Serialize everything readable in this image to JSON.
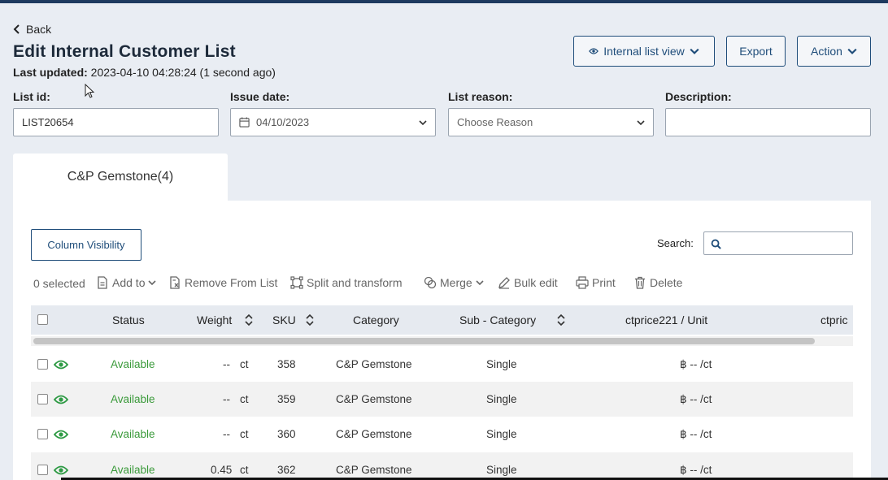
{
  "header": {
    "back_label": "Back",
    "title": "Edit Internal Customer List",
    "last_updated_label": "Last updated:",
    "last_updated_value": " 2023-04-10 04:28:24 (1 second ago)"
  },
  "actions": {
    "view_label": "Internal list view",
    "export_label": "Export",
    "action_label": "Action"
  },
  "fields": {
    "list_id_label": "List id:",
    "list_id_value": "LIST20654",
    "issue_date_label": "Issue date:",
    "issue_date_value": "04/10/2023",
    "list_reason_label": "List reason:",
    "list_reason_placeholder": "Choose Reason",
    "description_label": "Description:",
    "description_value": ""
  },
  "tabs": [
    {
      "label": "C&P Gemstone(4)"
    }
  ],
  "table_controls": {
    "column_visibility_label": "Column Visibility",
    "search_label": "Search:",
    "search_value": ""
  },
  "toolbar": {
    "selected_count": "0 selected",
    "add_to": "Add to",
    "remove_from_list": "Remove From List",
    "split_transform": "Split and transform",
    "merge": "Merge",
    "bulk_edit": "Bulk edit",
    "print": "Print",
    "delete": "Delete"
  },
  "table": {
    "columns": [
      "Status",
      "Weight",
      "SKU",
      "Category",
      "Sub - Category",
      "ctprice221 / Unit",
      "ctpric"
    ],
    "rows": [
      {
        "status": "Available",
        "weight": "--",
        "weight_unit": "ct",
        "sku": "358",
        "category": "C&P Gemstone",
        "sub_category": "Single",
        "price": "฿ -- /ct"
      },
      {
        "status": "Available",
        "weight": "--",
        "weight_unit": "ct",
        "sku": "359",
        "category": "C&P Gemstone",
        "sub_category": "Single",
        "price": "฿ -- /ct"
      },
      {
        "status": "Available",
        "weight": "--",
        "weight_unit": "ct",
        "sku": "360",
        "category": "C&P Gemstone",
        "sub_category": "Single",
        "price": "฿ -- /ct"
      },
      {
        "status": "Available",
        "weight": "0.45",
        "weight_unit": "ct",
        "sku": "362",
        "category": "C&P Gemstone",
        "sub_category": "Single",
        "price": "฿ -- /ct"
      }
    ]
  },
  "colors": {
    "accent": "#1f4d7a",
    "status_available": "#3a9a3a",
    "eye_icon": "#2e9a44",
    "background": "#e9edf3"
  },
  "icons": [
    "chevron-left-icon",
    "eye-icon",
    "chevron-down-icon",
    "calendar-icon",
    "search-icon",
    "add-doc-icon",
    "remove-doc-icon",
    "split-icon",
    "merge-icon",
    "edit-icon",
    "print-icon",
    "trash-icon",
    "sort-icon",
    "cursor-icon"
  ]
}
